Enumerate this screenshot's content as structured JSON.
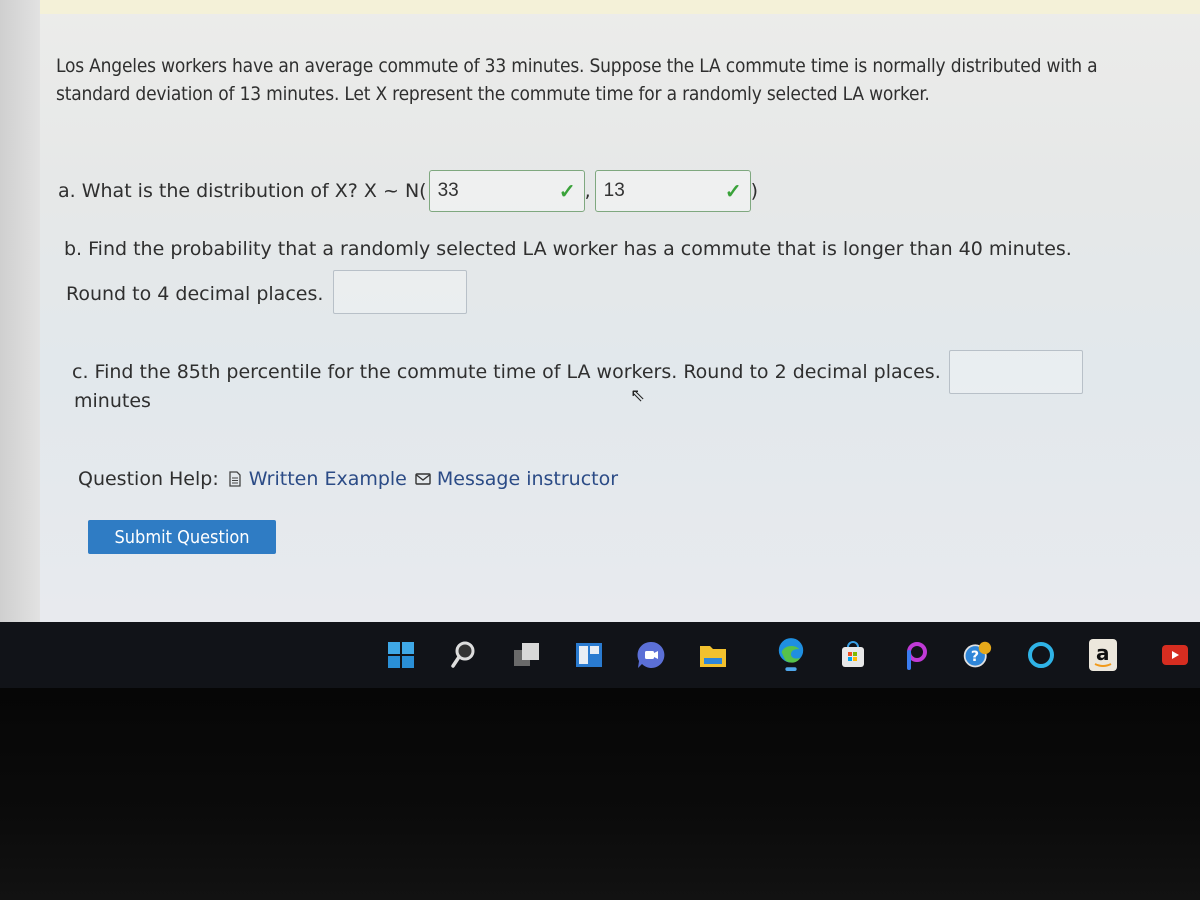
{
  "problem": {
    "intro": "Los Angeles workers have an average commute of 33 minutes. Suppose the LA commute time is normally distributed with a standard deviation of 13 minutes. Let X represent the commute time for a randomly selected LA worker."
  },
  "part_a": {
    "prompt": "a. What is the distribution of X? X ~ N(",
    "separator": ",",
    "close": ")",
    "mean_value": "33",
    "sd_value": "13",
    "check_glyph": "✓"
  },
  "part_b": {
    "line1": "b. Find the probability that a randomly selected LA worker has a commute that is longer than 40 minutes.",
    "line2": "Round to 4 decimal places.",
    "answer_value": ""
  },
  "part_c": {
    "line1": "c. Find the 85th percentile for the commute time of LA workers. Round to 2 decimal places.",
    "unit": "minutes",
    "answer_value": ""
  },
  "help": {
    "label": "Question Help:",
    "written_example": "Written Example",
    "message_instructor": "Message instructor"
  },
  "submit_label": "Submit Question",
  "taskbar": {
    "icons": [
      "windows-start",
      "search",
      "task-view",
      "widgets",
      "teams-chat",
      "file-explorer",
      "edge",
      "microsoft-store",
      "picsart",
      "help",
      "cortana",
      "amazon",
      "youtube"
    ]
  }
}
